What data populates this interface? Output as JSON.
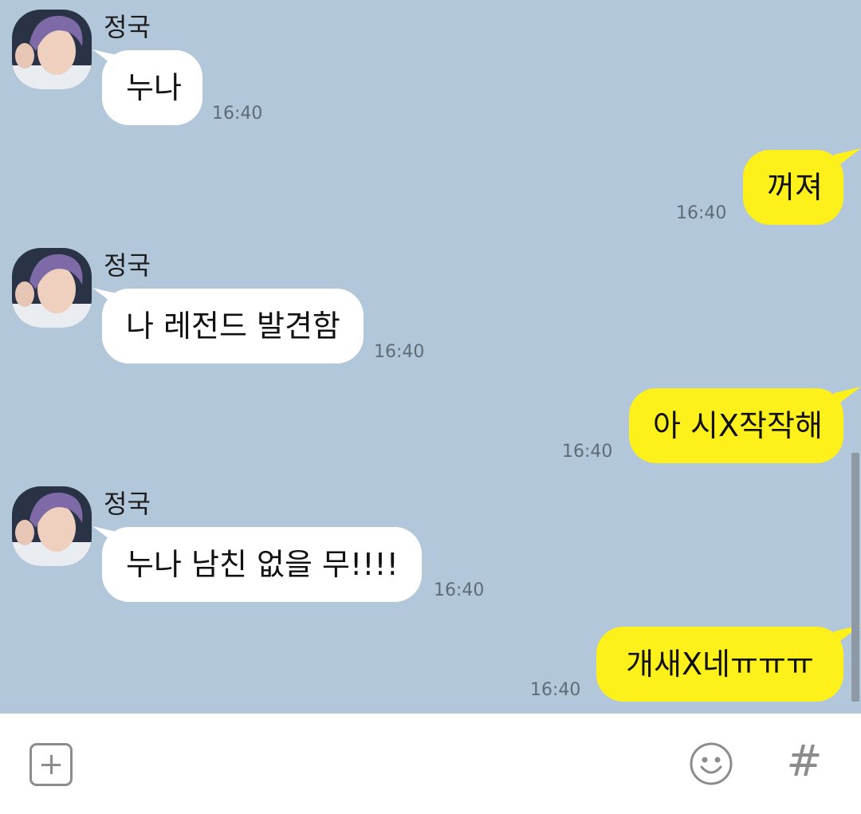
{
  "chat": {
    "background_color": "#b2c7da",
    "incoming_bubble_color": "#ffffff",
    "outgoing_bubble_color": "#fef01b",
    "messages": [
      {
        "direction": "in",
        "sender": "정국",
        "text": "누나",
        "time": "16:40"
      },
      {
        "direction": "out",
        "text": "꺼져",
        "time": "16:40"
      },
      {
        "direction": "in",
        "sender": "정국",
        "text": "나 레전드 발견함",
        "time": "16:40"
      },
      {
        "direction": "out",
        "text": "아 시X작작해",
        "time": "16:40"
      },
      {
        "direction": "in",
        "sender": "정국",
        "text": "누나 남친 없을 무!!!!",
        "time": "16:40"
      },
      {
        "direction": "out",
        "text": "개새X네ㅠㅠㅠ",
        "time": "16:40"
      }
    ]
  },
  "input_bar": {
    "icons": [
      "plus-icon",
      "emoji-icon",
      "hash-icon"
    ],
    "hash_symbol": "#"
  }
}
